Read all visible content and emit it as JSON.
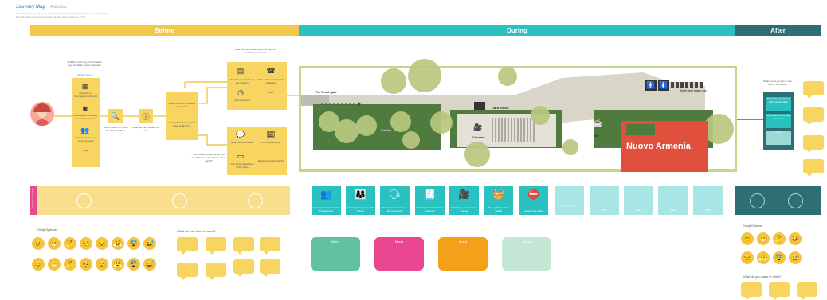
{
  "header": {
    "title": "Journey Map",
    "title_tag": "Aidrbhine -",
    "subtitle": "Nunc of mapping and journey mapping. Ut lovulatis a flitrage is frauncess minapli a hun, Nuoc the hutel conpemsion it finant of the-teaste scheme ut if hne."
  },
  "phases": {
    "before": "Before",
    "during": "During",
    "after": "After"
  },
  "before": {
    "question_top": "1. Where both eng of information you should for nuovo armenia?",
    "question_top_sub": "Riflette nuou",
    "sticky_1": "Thoughts on information and mood",
    "sticky_2": "Facebook or instagram on nuovo armenia",
    "sticky_3": "Personal reviews on nuovo armenia",
    "sticky_4": "Other",
    "search_caption": "Lorem ipsum the ghost chord friends Beer",
    "info_caption": "What are the problems of info",
    "mid_sticky_1": "I have found all necessary information",
    "mid_sticky_2": "I did not find all information I was looking for",
    "q_upper": "What are the the dentifiers you want to seen the Innovation?",
    "q_lower": "What kinds of technology you would like to help/support and or social?",
    "upper_a": "Detailed description of the problem",
    "upper_b": "Personal contact details of Italians",
    "upper_c": "Opening hours",
    "upper_d": "Other",
    "lower_a": "Instant communication",
    "lower_b": "Online reservation",
    "lower_c": "Full online description of the place",
    "lower_d": "Reviews of other clients",
    "feelings_label": "Feelings / Thoughts",
    "emoji_title": "Emoji Options",
    "mind_title": "What do you have in mind?"
  },
  "map": {
    "front_gate": "The Front gate",
    "card_check": "Card check",
    "garden": "Garden",
    "cinema": "Cinema",
    "bar": "Bar",
    "toilet": "Toilet and trash can",
    "place_name": "Nuovo Armenia"
  },
  "during": {
    "cards": [
      {
        "icon": "meeting-icon",
        "glyph": "👥",
        "label": "Arriving at the place with friends/family"
      },
      {
        "icon": "group-icon",
        "glyph": "👨‍👩‍👧",
        "label": "Entering the garden with friends"
      },
      {
        "icon": "presentation-icon",
        "glyph": "🗣",
        "label": "Meeting other people in the community"
      },
      {
        "icon": "order-icon",
        "glyph": "🧾",
        "label": "Ordering food and drinks at the bar"
      },
      {
        "icon": "cinema-icon",
        "glyph": "🎥",
        "label": "Watching a movie at the cinema"
      },
      {
        "icon": "shop-icon",
        "glyph": "🧺",
        "label": "Buying things at the market"
      },
      {
        "icon": "exit-icon",
        "glyph": "⛔",
        "label": "Leaving the place"
      }
    ],
    "light_cards": [
      "Other activity",
      "Other",
      "Other",
      "Other",
      "Other"
    ],
    "moods": [
      {
        "label": "Mood",
        "color": "#5fc1a1"
      },
      {
        "label": "Mood",
        "color": "#e94790"
      },
      {
        "label": "Mood",
        "color": "#f5a019"
      },
      {
        "label": "Mood",
        "color": "#c5e8d6"
      }
    ]
  },
  "after": {
    "question": "What would you like to see here in the future?",
    "card_1": "Share the experience with friends online",
    "card_2": "Come back to the place for events",
    "card_3": "Other",
    "emoji_title": "Emoji Options",
    "mind_title": "What do you have in mind?"
  },
  "emoji_rows": [
    "😊",
    "😁",
    "🤔",
    "🥺",
    "😒",
    "😤",
    "😨",
    "😅"
  ],
  "colors": {
    "yellow": "#f2c84b",
    "teal": "#2bc1c1",
    "dark_teal": "#2e6f73",
    "red": "#e0503c",
    "green": "#4f7b3f"
  }
}
